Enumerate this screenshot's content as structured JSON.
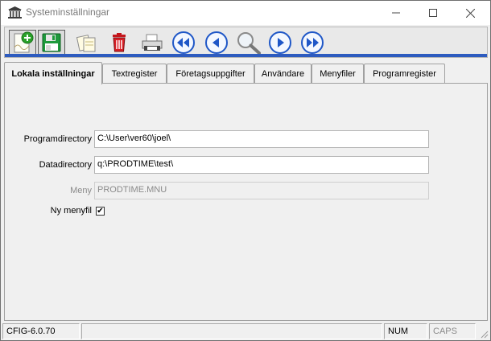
{
  "window": {
    "title": "Systeminställningar"
  },
  "toolbar": {
    "buttons": [
      {
        "name": "new-icon"
      },
      {
        "name": "save-icon"
      },
      {
        "name": "copy-icon"
      },
      {
        "name": "delete-icon"
      },
      {
        "name": "print-icon"
      },
      {
        "name": "first-record-icon"
      },
      {
        "name": "previous-record-icon"
      },
      {
        "name": "search-icon"
      },
      {
        "name": "next-record-icon"
      },
      {
        "name": "last-record-icon"
      }
    ]
  },
  "tabs": [
    {
      "label": "Lokala inställningar",
      "active": true
    },
    {
      "label": "Textregister"
    },
    {
      "label": "Företagsuppgifter"
    },
    {
      "label": "Användare"
    },
    {
      "label": "Menyfiler"
    },
    {
      "label": "Programregister"
    }
  ],
  "form": {
    "programdirectory": {
      "label": "Programdirectory",
      "value": "C:\\User\\ver60\\joel\\"
    },
    "datadirectory": {
      "label": "Datadirectory",
      "value": "q:\\PRODTIME\\test\\"
    },
    "meny": {
      "label": "Meny",
      "value": "PRODTIME.MNU"
    },
    "ny_menyfil": {
      "label": "Ny menyfil",
      "checked": true,
      "check_glyph": "✔"
    }
  },
  "statusbar": {
    "version": "CFIG-6.0.70",
    "message": "",
    "num": "NUM",
    "caps": "CAPS"
  },
  "colors": {
    "toolbar_accent": "#2d5bbf",
    "nav_button_blue": "#1f57c7"
  }
}
